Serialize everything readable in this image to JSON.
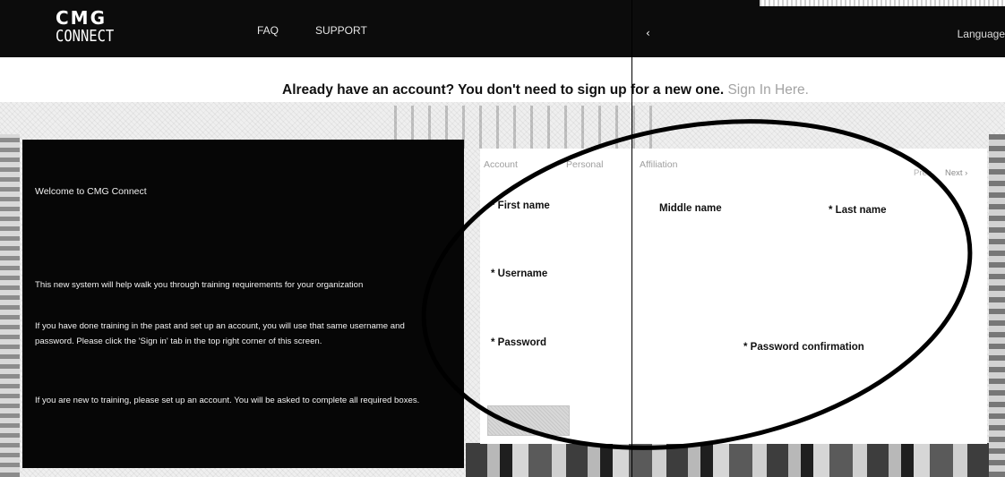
{
  "header": {
    "logo_line1": "CMG",
    "logo_line2": "CONNECT",
    "nav": [
      "FAQ",
      "SUPPORT"
    ],
    "chevron": "‹",
    "language_label": "Language"
  },
  "signin_prompt": {
    "text": "Already have an account? You don't need to sign up for a new one. ",
    "link_label": "Sign In Here."
  },
  "welcome": {
    "title": "Welcome to CMG Connect",
    "paragraphs": [
      "This new system will help walk you through training requirements for your organization",
      "If you have done training in the past and set up an account, you will use that same username and password. Please click the 'Sign in' tab in the top right corner of this screen.",
      "If you are new to training, please set up an account. You will be asked to complete all required boxes."
    ]
  },
  "form": {
    "tabs": [
      "Account",
      "Personal",
      "Affiliation"
    ],
    "prev_label": "Prev",
    "next_label": "Next ›",
    "fields": {
      "first_name": "* First name",
      "middle_name": "Middle name",
      "last_name": "* Last name",
      "username": "* Username",
      "password": "* Password",
      "password_confirmation": "* Password confirmation"
    }
  },
  "colors": {
    "nav_background": "#0c0c0c",
    "panel_background": "#060606",
    "link_gray": "#a3a3a3",
    "annotation_ink": "#000000"
  }
}
